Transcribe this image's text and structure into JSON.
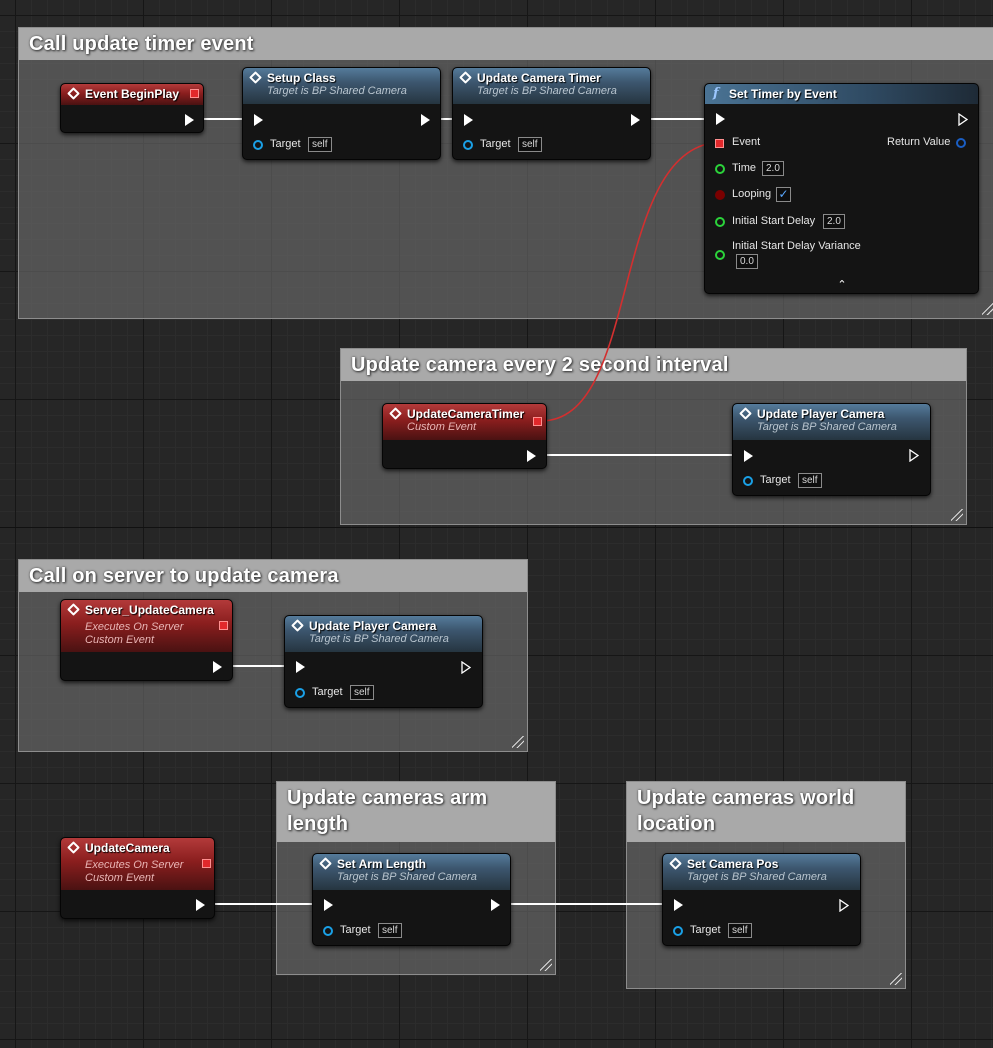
{
  "comments": {
    "timer": "Call update timer event",
    "interval": "Update camera every 2 second interval",
    "server": "Call on server to update camera",
    "arm_line1": "Update cameras arm",
    "arm_line2": "length",
    "loc_line1": "Update cameras world",
    "loc_line2": "location"
  },
  "nodes": {
    "event_begin_play": {
      "title": "Event BeginPlay"
    },
    "setup_class": {
      "title": "Setup Class",
      "subtitle": "Target is BP Shared Camera",
      "target_label": "Target",
      "target_value": "self"
    },
    "update_camera_timer_call": {
      "title": "Update Camera Timer",
      "subtitle": "Target is BP Shared Camera",
      "target_label": "Target",
      "target_value": "self"
    },
    "set_timer_by_event": {
      "icon": "f",
      "title": "Set Timer by Event",
      "event_label": "Event",
      "return_label": "Return Value",
      "time_label": "Time",
      "time_value": "2.0",
      "looping_label": "Looping",
      "looping_checked": "✓",
      "initial_delay_label": "Initial Start Delay",
      "initial_delay_value": "2.0",
      "variance_label": "Initial Start Delay Variance",
      "variance_value": "0.0",
      "collapse_glyph": "⌃"
    },
    "update_camera_timer_event": {
      "title": "UpdateCameraTimer",
      "subtitle": "Custom Event"
    },
    "update_player_camera_1": {
      "title": "Update Player Camera",
      "subtitle": "Target is BP Shared Camera",
      "target_label": "Target",
      "target_value": "self"
    },
    "server_update_camera": {
      "title": "Server_UpdateCamera",
      "subtitle1": "Executes On Server",
      "subtitle2": "Custom Event"
    },
    "update_player_camera_2": {
      "title": "Update Player Camera",
      "subtitle": "Target is BP Shared Camera",
      "target_label": "Target",
      "target_value": "self"
    },
    "update_camera": {
      "title": "UpdateCamera",
      "subtitle1": "Executes On Server",
      "subtitle2": "Custom Event"
    },
    "set_arm_length": {
      "title": "Set Arm Length",
      "subtitle": "Target is BP Shared Camera",
      "target_label": "Target",
      "target_value": "self"
    },
    "set_camera_pos": {
      "title": "Set Camera Pos",
      "subtitle": "Target is BP Shared Camera",
      "target_label": "Target",
      "target_value": "self"
    }
  },
  "colors": {
    "comment_header": "#a9a9a9",
    "function_header": "#3c566e",
    "event_header": "#8a1e1e",
    "delegate_wire": "#d32f2f",
    "exec_wire": "#ffffff"
  }
}
